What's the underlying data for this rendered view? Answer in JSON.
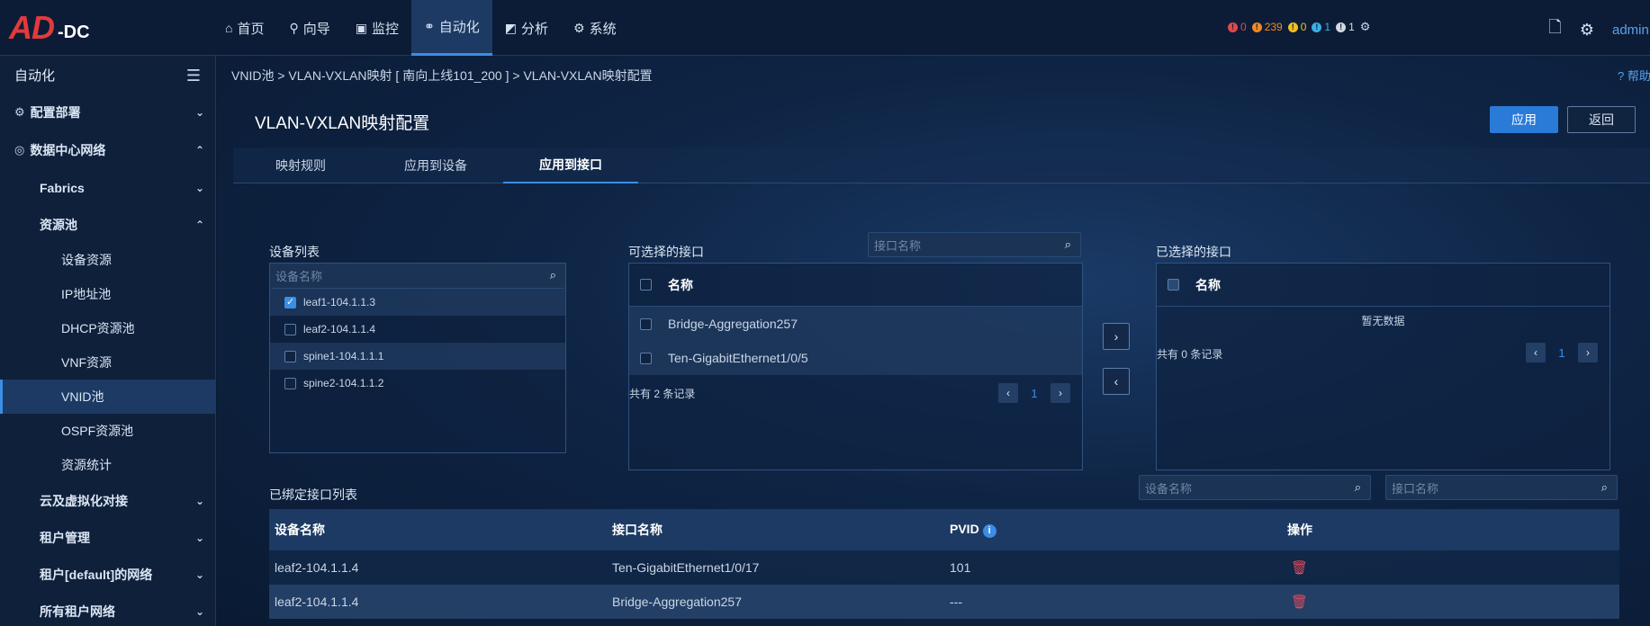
{
  "brand": {
    "logo_main": "AD",
    "logo_sub": "-DC"
  },
  "nav": [
    {
      "icon": "⌂",
      "label": "首页"
    },
    {
      "icon": "⚲",
      "label": "向导"
    },
    {
      "icon": "▣",
      "label": "监控"
    },
    {
      "icon": "⚭",
      "label": "自动化"
    },
    {
      "icon": "◩",
      "label": "分析"
    },
    {
      "icon": "⚙",
      "label": "系统"
    }
  ],
  "alarms": [
    {
      "color": "#e04a4a",
      "count": "0"
    },
    {
      "color": "#f08a24",
      "count": "239"
    },
    {
      "color": "#f0c020",
      "count": "0"
    },
    {
      "color": "#3ab0e6",
      "count": "1"
    },
    {
      "color": "#d0d8e4",
      "count": "1"
    }
  ],
  "user": {
    "name": "admin"
  },
  "sidebar": {
    "title": "自动化",
    "items": [
      {
        "label": "配置部署"
      },
      {
        "label": "数据中心网络"
      },
      {
        "label": "Fabrics"
      },
      {
        "label": "资源池"
      },
      {
        "label": "设备资源"
      },
      {
        "label": "IP地址池"
      },
      {
        "label": "DHCP资源池"
      },
      {
        "label": "VNF资源"
      },
      {
        "label": "VNID池"
      },
      {
        "label": "OSPF资源池"
      },
      {
        "label": "资源统计"
      },
      {
        "label": "云及虚拟化对接"
      },
      {
        "label": "租户管理"
      },
      {
        "label": "租户[default]的网络"
      },
      {
        "label": "所有租户网络"
      }
    ]
  },
  "breadcrumb": "VNID池 > VLAN-VXLAN映射 [ 南向上线101_200 ] > VLAN-VXLAN映射配置",
  "help": "帮助",
  "page": {
    "title": "VLAN-VXLAN映射配置",
    "apply_label": "应用",
    "back_label": "返回"
  },
  "tabs": [
    {
      "label": "映射规则"
    },
    {
      "label": "应用到设备"
    },
    {
      "label": "应用到接口"
    }
  ],
  "device_panel": {
    "label": "设备列表",
    "search_placeholder": "设备名称",
    "devices": [
      {
        "name": "leaf1-104.1.1.3",
        "checked": true
      },
      {
        "name": "leaf2-104.1.1.4",
        "checked": false
      },
      {
        "name": "spine1-104.1.1.1",
        "checked": false
      },
      {
        "name": "spine2-104.1.1.2",
        "checked": false
      }
    ]
  },
  "available_panel": {
    "label": "可选择的接口",
    "search_placeholder": "接口名称",
    "header": "名称",
    "rows": [
      "Bridge-Aggregation257",
      "Ten-GigabitEthernet1/0/5"
    ],
    "total": "共有 2 条记录",
    "page": "1"
  },
  "selected_panel": {
    "label": "已选择的接口",
    "header": "名称",
    "empty": "暂无数据",
    "total": "共有 0 条记录",
    "page": "1"
  },
  "bound_list": {
    "label": "已绑定接口列表",
    "device_search_placeholder": "设备名称",
    "iface_search_placeholder": "接口名称",
    "columns": [
      "设备名称",
      "接口名称",
      "PVID",
      "操作"
    ],
    "rows": [
      {
        "device": "leaf2-104.1.1.4",
        "iface": "Ten-GigabitEthernet1/0/17",
        "pvid": "101"
      },
      {
        "device": "leaf2-104.1.1.4",
        "iface": "Bridge-Aggregation257",
        "pvid": "---"
      }
    ]
  }
}
